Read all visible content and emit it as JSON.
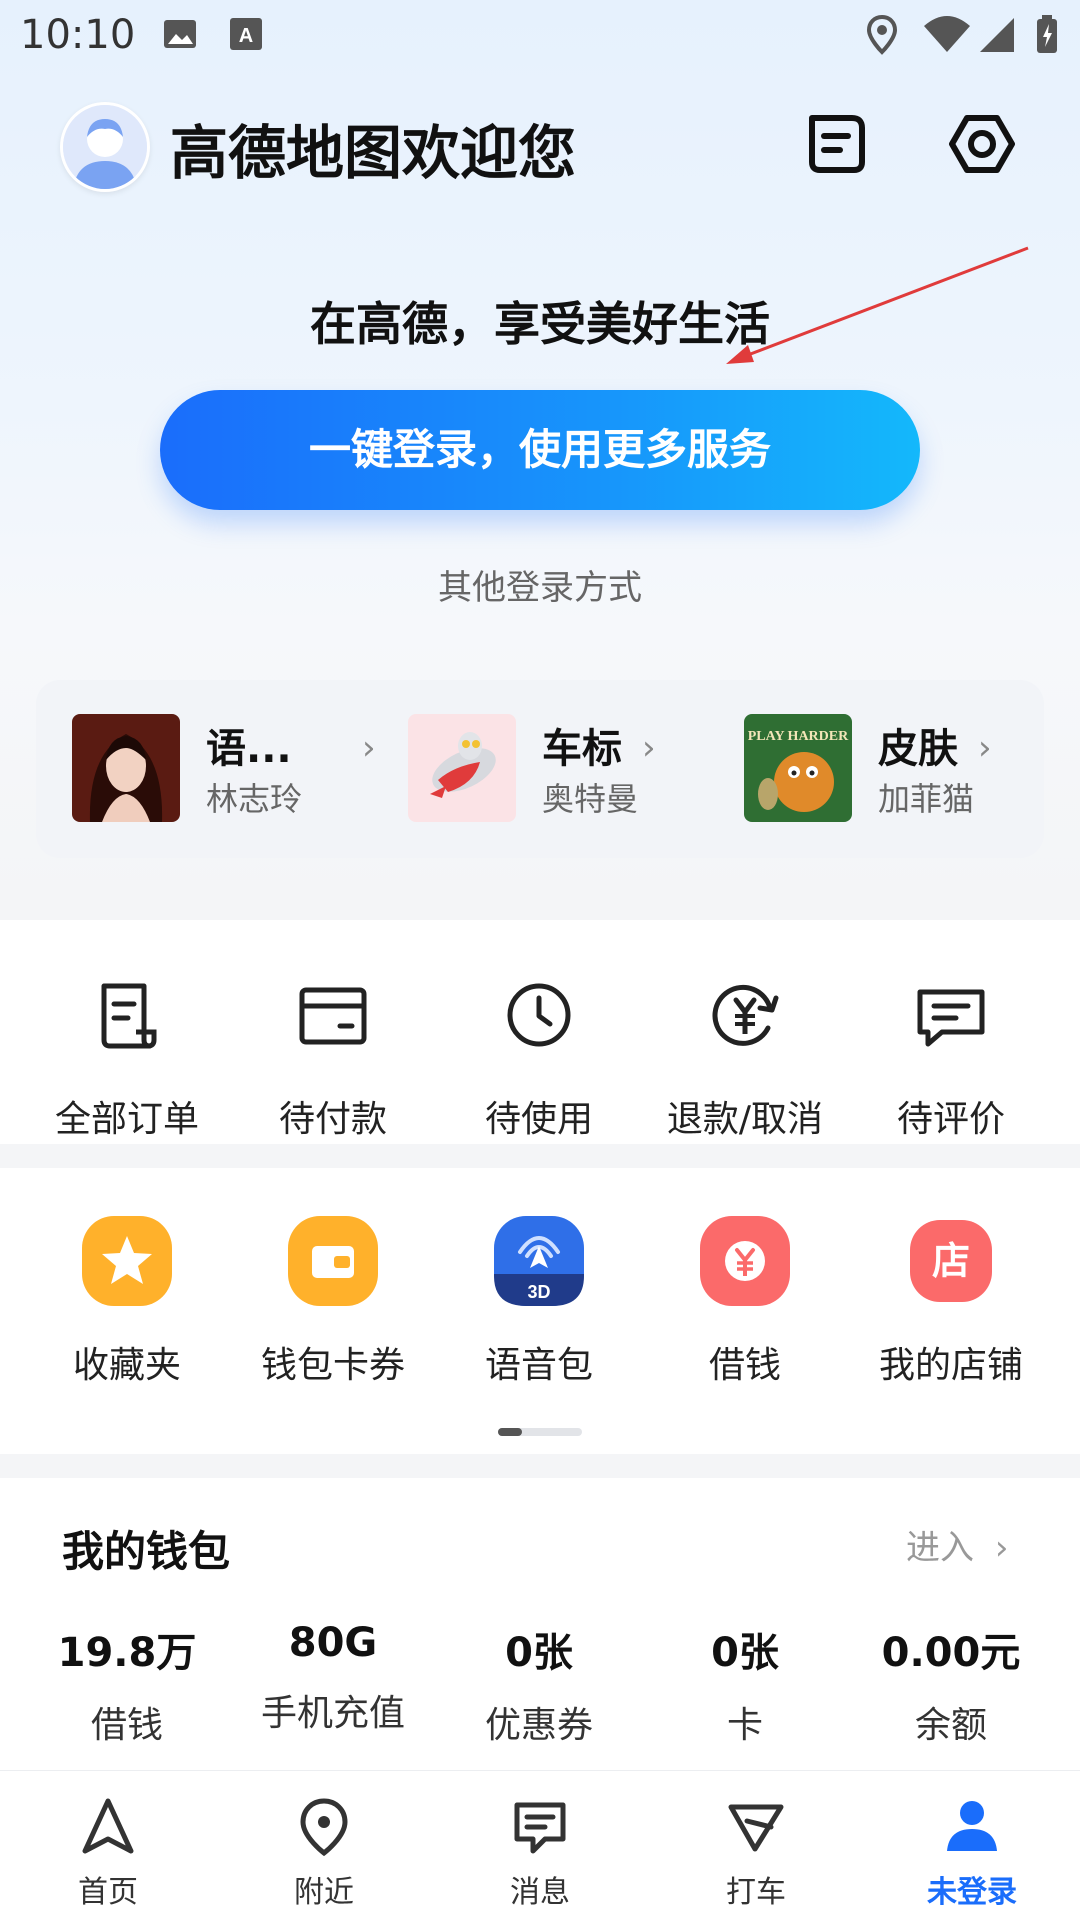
{
  "status_bar": {
    "time": "10:10"
  },
  "header": {
    "welcome": "高德地图欢迎您"
  },
  "login": {
    "slogan": "在高德，享受美好生活",
    "button_label": "一键登录，使用更多服务",
    "other_methods": "其他登录方式"
  },
  "promo": {
    "items": [
      {
        "title": "语...",
        "subtitle": "林志玲"
      },
      {
        "title": "车标",
        "subtitle": "奥特曼"
      },
      {
        "title": "皮肤",
        "subtitle": "加菲猫",
        "thumb_text": "PLAY HARDER"
      }
    ]
  },
  "orders": {
    "items": [
      {
        "label": "全部订单",
        "icon": "order-list-icon"
      },
      {
        "label": "待付款",
        "icon": "wallet-card-icon"
      },
      {
        "label": "待使用",
        "icon": "clock-icon"
      },
      {
        "label": "退款/取消",
        "icon": "refund-icon"
      },
      {
        "label": "待评价",
        "icon": "comment-icon"
      }
    ]
  },
  "tools": {
    "items": [
      {
        "label": "收藏夹",
        "icon": "star-icon",
        "color": "#ffb12b"
      },
      {
        "label": "钱包卡券",
        "icon": "wallet-icon",
        "color": "#ffb12b"
      },
      {
        "label": "语音包",
        "icon": "voice-3d-icon",
        "color": "#2f6fe8",
        "badge": "3D"
      },
      {
        "label": "借钱",
        "icon": "yuan-icon",
        "color": "#fb6a6a"
      },
      {
        "label": "我的店铺",
        "icon": "shop-icon",
        "color": "#fb6a6a",
        "glyph": "店"
      }
    ]
  },
  "wallet": {
    "title": "我的钱包",
    "enter_label": "进入",
    "items": [
      {
        "value": "19.8万",
        "label": "借钱"
      },
      {
        "value": "80G",
        "label": "手机充值"
      },
      {
        "value": "0张",
        "label": "优惠券"
      },
      {
        "value": "0张",
        "label": "卡"
      },
      {
        "value": "0.00元",
        "label": "余额"
      }
    ]
  },
  "bottom_nav": {
    "items": [
      {
        "label": "首页",
        "icon": "navigation-arrow-icon"
      },
      {
        "label": "附近",
        "icon": "location-pin-icon"
      },
      {
        "label": "消息",
        "icon": "message-icon"
      },
      {
        "label": "打车",
        "icon": "taxi-icon"
      },
      {
        "label": "未登录",
        "icon": "user-icon",
        "active": true
      }
    ]
  },
  "colors": {
    "accent": "#1a6dfb",
    "orange": "#ffb12b",
    "red": "#fb6a6a"
  }
}
